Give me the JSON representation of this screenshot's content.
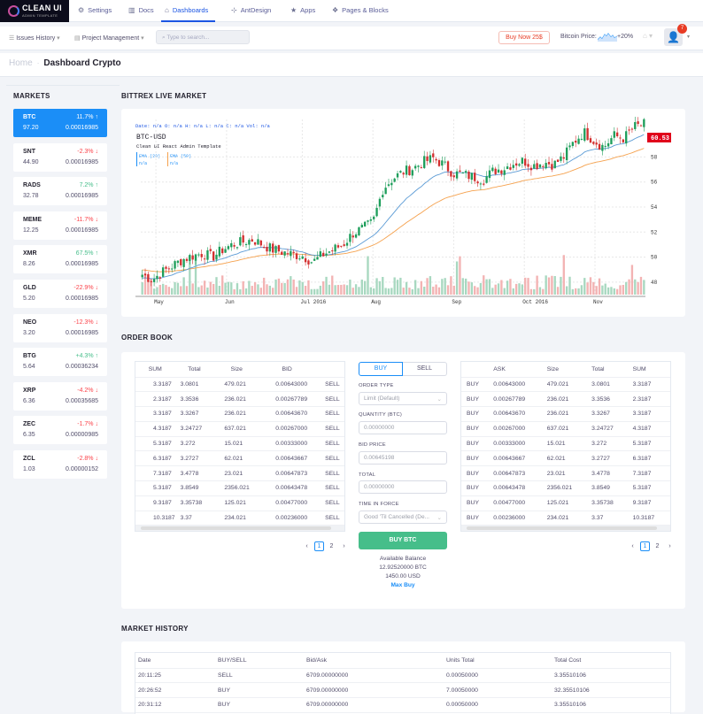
{
  "logo": {
    "title": "CLEAN UI",
    "subtitle": "ADMIN TEMPLATE"
  },
  "topnav": [
    {
      "label": "Settings",
      "icon": "gear-icon",
      "glyph": "⚙"
    },
    {
      "label": "Docs",
      "icon": "book-icon",
      "glyph": "▥"
    },
    {
      "label": "Dashboards",
      "icon": "home-icon",
      "glyph": "⌂"
    },
    {
      "label": "AntDesign",
      "icon": "antdesign-icon",
      "glyph": "⊹"
    },
    {
      "label": "Apps",
      "icon": "star-icon",
      "glyph": "★"
    },
    {
      "label": "Pages & Blocks",
      "icon": "layers-icon",
      "glyph": "❖"
    }
  ],
  "subbar": {
    "issues": "Issues History",
    "project": "Project Management",
    "search_placeholder": "Type to search...",
    "buy_now": "Buy Now 25$",
    "btc_label": "Bitcoin Price:",
    "btc_change": "+20%",
    "notifications": "7"
  },
  "breadcrumb": {
    "home": "Home",
    "current": "Dashboard Crypto"
  },
  "sections": {
    "markets": "MARKETS",
    "live": "BITTREX LIVE MARKET",
    "orderbook": "ORDER BOOK",
    "history": "MARKET HISTORY"
  },
  "markets": [
    {
      "name": "BTC",
      "change": "11.7%",
      "dir": "up",
      "price": "97.20",
      "volume": "0.00016985"
    },
    {
      "name": "SNT",
      "change": "-2.3%",
      "dir": "down",
      "price": "44.90",
      "volume": "0.00016985"
    },
    {
      "name": "RADS",
      "change": "7.2%",
      "dir": "up",
      "price": "32.78",
      "volume": "0.00016985"
    },
    {
      "name": "MEME",
      "change": "-11.7%",
      "dir": "down",
      "price": "12.25",
      "volume": "0.00016985"
    },
    {
      "name": "XMR",
      "change": "67.5%",
      "dir": "up",
      "price": "8.26",
      "volume": "0.00016985"
    },
    {
      "name": "GLD",
      "change": "-22.9%",
      "dir": "down",
      "price": "5.20",
      "volume": "0.00016985"
    },
    {
      "name": "NEO",
      "change": "-12.3%",
      "dir": "down",
      "price": "3.20",
      "volume": "0.00016985"
    },
    {
      "name": "BTG",
      "change": "+4.3%",
      "dir": "up",
      "price": "5.64",
      "volume": "0.00036234"
    },
    {
      "name": "XRP",
      "change": "-4.2%",
      "dir": "down",
      "price": "6.36",
      "volume": "0.00035685"
    },
    {
      "name": "ZEC",
      "change": "-1.7%",
      "dir": "down",
      "price": "6.35",
      "volume": "0.00000985"
    },
    {
      "name": "ZCL",
      "change": "-2.8%",
      "dir": "down",
      "price": "1.03",
      "volume": "0.00000152"
    }
  ],
  "chart": {
    "info_line": "Date: n/a O: n/a H: n/a L: n/a C: n/a Vol: n/a",
    "pair": "BTC-USD",
    "subtitle": "Clean UI React Admin Template",
    "ema20_label": "EMA (20)",
    "ema50_label": "EMA (50)",
    "na": "n/a",
    "last_price": "60.53",
    "y_ticks": [
      "48",
      "50",
      "52",
      "54",
      "56",
      "58"
    ],
    "x_ticks": [
      "May",
      "Jun",
      "Jul 2016",
      "Aug",
      "Sep",
      "Oct 2016",
      "Nov"
    ]
  },
  "chart_data": {
    "type": "candlestick",
    "title": "BTC-USD",
    "x_ticks": [
      "May",
      "Jun",
      "Jul 2016",
      "Aug",
      "Sep",
      "Oct 2016",
      "Nov"
    ],
    "ylim": [
      47,
      61
    ],
    "close_series_approx": [
      48.6,
      48.2,
      48.8,
      49.3,
      49.8,
      50.1,
      50.3,
      50.0,
      50.6,
      51.0,
      51.2,
      51.4,
      51.0,
      50.6,
      50.4,
      50.2,
      50.1,
      49.6,
      50.2,
      50.6,
      51.0,
      51.9,
      52.3,
      52.8,
      55.5,
      56.3,
      56.8,
      57.1,
      57.6,
      57.9,
      57.4,
      56.7,
      56.6,
      56.4,
      56.2,
      56.9,
      57.1,
      57.5,
      57.7,
      57.3,
      57.6,
      57.4,
      58.0,
      59.2,
      60.0,
      59.3,
      58.8,
      59.7,
      59.5,
      60.4,
      60.6
    ],
    "series": [
      {
        "name": "EMA (20)"
      },
      {
        "name": "EMA (50)"
      }
    ]
  },
  "orderbook": {
    "headers_left": [
      "SUM",
      "Total",
      "Size",
      "BID",
      ""
    ],
    "headers_right": [
      "",
      "ASK",
      "Size",
      "Total",
      "SUM"
    ],
    "sell_label": "SELL",
    "buy_label": "BUY",
    "rows": [
      {
        "sum": "3.3187",
        "total": "3.0801",
        "size": "479.021",
        "price": "0.00643000"
      },
      {
        "sum": "2.3187",
        "total": "3.3536",
        "size": "236.021",
        "price": "0.00267789"
      },
      {
        "sum": "3.3187",
        "total": "3.3267",
        "size": "236.021",
        "price": "0.00643670"
      },
      {
        "sum": "4.3187",
        "total": "3.24727",
        "size": "637.021",
        "price": "0.00267000"
      },
      {
        "sum": "5.3187",
        "total": "3.272",
        "size": "15.021",
        "price": "0.00333000"
      },
      {
        "sum": "6.3187",
        "total": "3.2727",
        "size": "62.021",
        "price": "0.00643667"
      },
      {
        "sum": "7.3187",
        "total": "3.4778",
        "size": "23.021",
        "price": "0.00647873"
      },
      {
        "sum": "5.3187",
        "total": "3.8549",
        "size": "2356.021",
        "price": "0.00643478"
      },
      {
        "sum": "9.3187",
        "total": "3.35738",
        "size": "125.021",
        "price": "0.00477000"
      },
      {
        "sum": "10.3187",
        "total": "3.37",
        "size": "234.021",
        "price": "0.00236000"
      }
    ],
    "pages": [
      "‹",
      "1",
      "2",
      "›"
    ]
  },
  "form": {
    "tab_buy": "BUY",
    "tab_sell": "SELL",
    "order_type_label": "ORDER TYPE",
    "order_type_value": "Limit (Default)",
    "quantity_label": "QUANTITY (BTC)",
    "quantity_value": "0.00000000",
    "bid_label": "BID PRICE",
    "bid_value": "0.00645198",
    "total_label": "TOTAL",
    "total_value": "0.00000000",
    "tif_label": "TIME IN FORCE",
    "tif_value": "Good 'Til Cancelled (De...",
    "submit": "BUY BTC",
    "balance_label": "Available Balance",
    "balance_btc": "12.92520000 BTC",
    "balance_usd": "1450.00 USD",
    "max_buy": "Max Buy"
  },
  "history": {
    "headers": [
      "Date",
      "BUY/SELL",
      "Bid/Ask",
      "Units Total",
      "Total Cost"
    ],
    "rows": [
      {
        "date": "20:11:25",
        "side": "SELL",
        "price": "6709.00000000",
        "units": "0.00050000",
        "cost": "3.35510106"
      },
      {
        "date": "20:26:52",
        "side": "BUY",
        "price": "6709.00000000",
        "units": "7.00050000",
        "cost": "32.35510106"
      },
      {
        "date": "20:31:12",
        "side": "BUY",
        "price": "6709.00000000",
        "units": "0.00050000",
        "cost": "3.35510106"
      }
    ]
  }
}
